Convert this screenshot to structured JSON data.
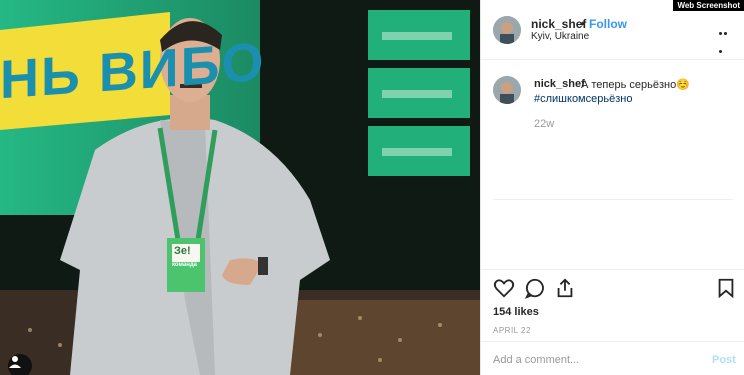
{
  "watermark": "Web Screenshot",
  "photo": {
    "banner_text": "НЬ ВИБО",
    "badge_text": "Зе!",
    "badge_sub": "команда"
  },
  "header": {
    "username": "nick_shef",
    "separator": "•",
    "follow_label": "Follow",
    "location": "Kyiv, Ukraine"
  },
  "caption": {
    "username": "nick_shef",
    "text": "А теперь серьёзно☺️",
    "hashtag": "#слишкомсерьёзно",
    "age": "22w"
  },
  "stats": {
    "likes": "154 likes",
    "date": "APRIL 22"
  },
  "comment": {
    "placeholder": "Add a comment...",
    "post_label": "Post"
  },
  "colors": {
    "accent": "#3897f0",
    "screen_green": "#1fb277",
    "banner_yellow": "#f5e03a"
  },
  "icons": [
    "heart-icon",
    "comment-icon",
    "share-icon",
    "bookmark-icon",
    "more-options-icon",
    "user-icon"
  ]
}
